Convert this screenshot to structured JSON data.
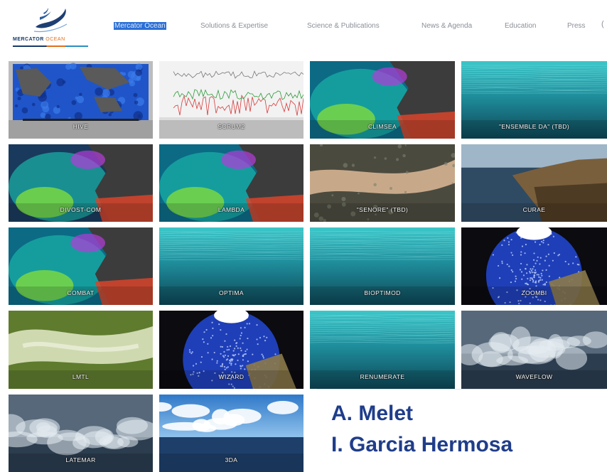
{
  "header": {
    "logo_text_primary": "MERCATOR",
    "logo_text_accent": "OCEAN",
    "nav": [
      {
        "label": "Mercator Ocean",
        "active": true
      },
      {
        "label": "Solutions & Expertise",
        "active": false
      },
      {
        "label": "Science & Publications",
        "active": false
      },
      {
        "label": "News & Agenda",
        "active": false
      },
      {
        "label": "Education",
        "active": false
      },
      {
        "label": "Press",
        "active": false
      }
    ]
  },
  "tiles": [
    {
      "label": "HIVE",
      "art": "world-map-icon"
    },
    {
      "label": "SCRUM2",
      "art": "time-series-icon"
    },
    {
      "label": "CLIMSEA",
      "art": "sst-map-icon"
    },
    {
      "label": "\"ENSEMBLE DA\" (tbd)",
      "art": "underwater-icon"
    },
    {
      "label": "DIVOST-COM",
      "art": "chlorophyll-map-icon"
    },
    {
      "label": "LAMBDA",
      "art": "sst-map-icon"
    },
    {
      "label": "\"SENORE\" (tbd)",
      "art": "river-delta-icon"
    },
    {
      "label": "CURAE",
      "art": "coastline-icon"
    },
    {
      "label": "COMBAT",
      "art": "sst-map-icon"
    },
    {
      "label": "OPTIMA",
      "art": "underwater-icon"
    },
    {
      "label": "BIOPTIMOD",
      "art": "underwater-icon"
    },
    {
      "label": "ZOOMBI",
      "art": "globe-icon"
    },
    {
      "label": "LMTL",
      "art": "green-map-icon"
    },
    {
      "label": "WIZARD",
      "art": "globe-icon"
    },
    {
      "label": "RENUMERATE",
      "art": "underwater-icon"
    },
    {
      "label": "WAVEFLOW",
      "art": "waves-icon"
    },
    {
      "label": "LATEMAR",
      "art": "waves-icon"
    },
    {
      "label": "3DA",
      "art": "sky-sea-icon"
    }
  ],
  "credits": {
    "line1": "A. Melet",
    "line2": "I. Garcia Hermosa"
  }
}
